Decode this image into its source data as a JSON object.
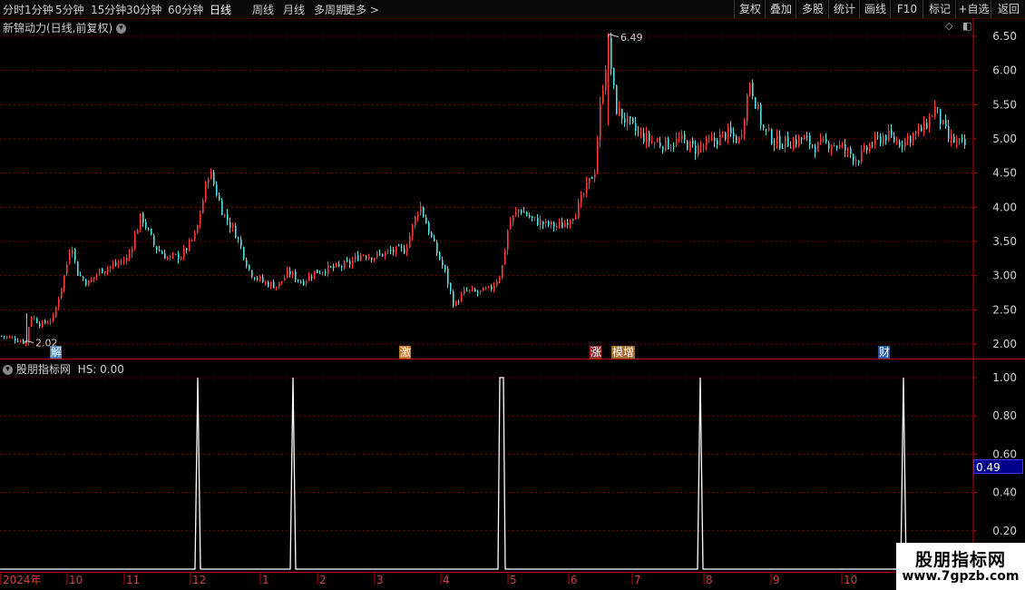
{
  "toolbar": {
    "periods": [
      "分时",
      "1分钟",
      "5分钟",
      "15分钟",
      "30分钟",
      "60分钟",
      "日线",
      "周线",
      "月线",
      "多周期",
      "更多 >"
    ],
    "active_period": "日线",
    "right_buttons": [
      "复权",
      "叠加",
      "多股",
      "统计",
      "画线",
      "F10",
      "标记",
      "+自选",
      "返回"
    ]
  },
  "main_panel": {
    "title": "新锦动力(日线,前复权)",
    "high_label": "6.49",
    "low_label": "2.02",
    "markers": [
      {
        "text": "解",
        "color": "#4a7fb0",
        "date_index": 32
      },
      {
        "text": "激",
        "color": "#c8782a",
        "date_index": 238
      },
      {
        "text": "涨",
        "color": "#a02a2a",
        "date_index": 353
      },
      {
        "text": "模增",
        "color": "#a06a2a",
        "date_index": 370
      },
      {
        "text": "财",
        "color": "#2a5aa0",
        "date_index": 526
      }
    ]
  },
  "sub_panel": {
    "title": "股朋指标网",
    "hs_label": "HS: 0.00",
    "current_value_label": "0.49"
  },
  "date_axis": {
    "labels": [
      "2024年",
      "10",
      "11",
      "12",
      "1",
      "2",
      "3",
      "4",
      "5",
      "6",
      "7",
      "8",
      "9",
      "10"
    ]
  },
  "watermark": {
    "line1": "股朋指标网",
    "line2": "www.7gpzb.com"
  },
  "colors": {
    "up": "#ff3a3a",
    "down": "#54e0e0",
    "grid": "#7a0000",
    "axis": "#c00000",
    "line": "#ffffff"
  },
  "chart_data": [
    {
      "type": "candlestick",
      "title": "新锦动力(日线,前复权)",
      "ylim": [
        1.85,
        6.65
      ],
      "yticks": [
        2.0,
        2.5,
        3.0,
        3.5,
        4.0,
        4.5,
        5.0,
        5.5,
        6.0,
        6.5
      ],
      "x_labels": [
        "2024年",
        "10",
        "11",
        "12",
        "1",
        "2",
        "3",
        "4",
        "5",
        "6",
        "7",
        "8",
        "9",
        "10"
      ],
      "price_path": [
        [
          0,
          2.12
        ],
        [
          15,
          2.08
        ],
        [
          28,
          2.02
        ],
        [
          33,
          2.42
        ],
        [
          45,
          2.28
        ],
        [
          58,
          2.38
        ],
        [
          72,
          3.1
        ],
        [
          78,
          3.52
        ],
        [
          84,
          3.05
        ],
        [
          96,
          2.88
        ],
        [
          110,
          3.08
        ],
        [
          125,
          3.15
        ],
        [
          140,
          3.25
        ],
        [
          155,
          3.88
        ],
        [
          170,
          3.42
        ],
        [
          185,
          3.25
        ],
        [
          200,
          3.3
        ],
        [
          215,
          3.6
        ],
        [
          230,
          4.55
        ],
        [
          245,
          3.92
        ],
        [
          260,
          3.6
        ],
        [
          275,
          3.05
        ],
        [
          290,
          2.9
        ],
        [
          305,
          2.85
        ],
        [
          318,
          3.05
        ],
        [
          332,
          2.9
        ],
        [
          346,
          3.05
        ],
        [
          360,
          3.1
        ],
        [
          372,
          3.12
        ],
        [
          385,
          3.18
        ],
        [
          398,
          3.32
        ],
        [
          412,
          3.28
        ],
        [
          430,
          3.35
        ],
        [
          446,
          3.38
        ],
        [
          462,
          4.05
        ],
        [
          476,
          3.5
        ],
        [
          490,
          3.05
        ],
        [
          500,
          2.55
        ],
        [
          512,
          2.78
        ],
        [
          526,
          2.75
        ],
        [
          540,
          2.8
        ],
        [
          552,
          3.05
        ],
        [
          560,
          3.75
        ],
        [
          572,
          3.98
        ],
        [
          586,
          3.82
        ],
        [
          600,
          3.75
        ],
        [
          618,
          3.72
        ],
        [
          635,
          3.95
        ],
        [
          655,
          4.55
        ],
        [
          662,
          5.6
        ],
        [
          670,
          6.4
        ],
        [
          678,
          5.45
        ],
        [
          690,
          5.25
        ],
        [
          705,
          5.05
        ],
        [
          720,
          4.95
        ],
        [
          735,
          4.92
        ],
        [
          750,
          4.98
        ],
        [
          765,
          4.85
        ],
        [
          780,
          4.92
        ],
        [
          800,
          5.08
        ],
        [
          815,
          4.98
        ],
        [
          826,
          5.85
        ],
        [
          840,
          5.15
        ],
        [
          855,
          4.95
        ],
        [
          870,
          4.95
        ],
        [
          885,
          5.0
        ],
        [
          900,
          4.88
        ],
        [
          915,
          4.95
        ],
        [
          930,
          4.85
        ],
        [
          945,
          4.7
        ],
        [
          960,
          4.92
        ],
        [
          975,
          5.05
        ],
        [
          990,
          4.95
        ],
        [
          1005,
          5.05
        ],
        [
          1018,
          5.15
        ],
        [
          1030,
          5.45
        ],
        [
          1045,
          5.0
        ],
        [
          1062,
          4.9
        ]
      ],
      "high": 6.49,
      "low": 2.02
    },
    {
      "type": "line",
      "title": "股朋指标网",
      "series": [
        {
          "name": "HS",
          "values": "spikes to 1.00 at dates ~ Nov-28, Jan-19, Apr-30/May-2, Jul-30, Sep-30 else 0.00"
        }
      ],
      "ylim": [
        0,
        1.05
      ],
      "yticks": [
        0.2,
        0.4,
        0.6,
        0.8,
        1.0
      ],
      "spikes": [
        {
          "date": "Dec",
          "value": 1.0
        },
        {
          "date": "Jan",
          "value": 1.0
        },
        {
          "date": "May",
          "value": 1.0
        },
        {
          "date": "Aug",
          "value": 1.0
        },
        {
          "date": "Oct",
          "value": 1.0
        }
      ],
      "last_value": 0.49
    }
  ]
}
